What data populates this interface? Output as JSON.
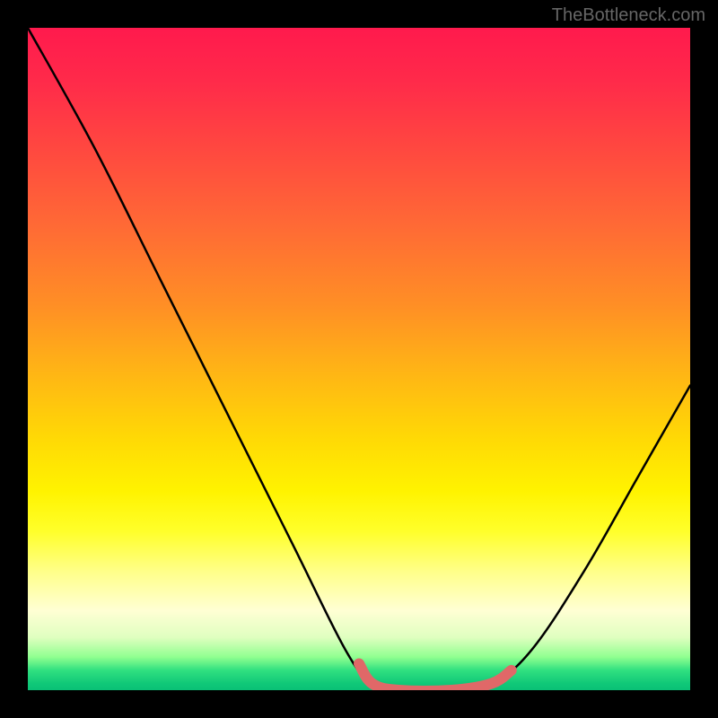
{
  "watermark": "TheBottleneck.com",
  "chart_data": {
    "type": "line",
    "title": "",
    "xlabel": "",
    "ylabel": "",
    "xlim": [
      0,
      100
    ],
    "ylim": [
      0,
      100
    ],
    "curve": {
      "name": "bottleneck-curve",
      "points": [
        {
          "x": 0,
          "y": 100
        },
        {
          "x": 10,
          "y": 82
        },
        {
          "x": 20,
          "y": 62
        },
        {
          "x": 30,
          "y": 42
        },
        {
          "x": 40,
          "y": 22
        },
        {
          "x": 48,
          "y": 6
        },
        {
          "x": 52,
          "y": 1
        },
        {
          "x": 56,
          "y": 0
        },
        {
          "x": 64,
          "y": 0
        },
        {
          "x": 70,
          "y": 1
        },
        {
          "x": 76,
          "y": 6
        },
        {
          "x": 84,
          "y": 18
        },
        {
          "x": 92,
          "y": 32
        },
        {
          "x": 100,
          "y": 46
        }
      ]
    },
    "highlight_segment": {
      "name": "optimal-range",
      "color": "#e06868",
      "points": [
        {
          "x": 50,
          "y": 4
        },
        {
          "x": 52,
          "y": 1
        },
        {
          "x": 56,
          "y": 0
        },
        {
          "x": 64,
          "y": 0
        },
        {
          "x": 70,
          "y": 1
        },
        {
          "x": 73,
          "y": 3
        }
      ]
    },
    "background": "thermal-gradient"
  }
}
